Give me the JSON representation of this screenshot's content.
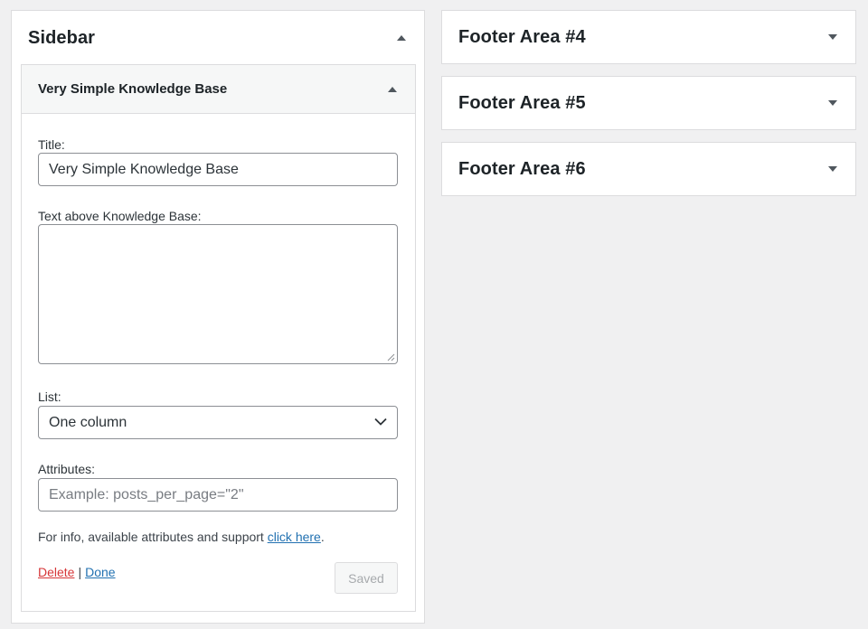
{
  "sidebar": {
    "title": "Sidebar",
    "widget": {
      "title": "Very Simple Knowledge Base",
      "title_label": "Title:",
      "title_value": "Very Simple Knowledge Base",
      "text_label": "Text above Knowledge Base:",
      "text_value": "",
      "list_label": "List:",
      "list_value": "One column",
      "attributes_label": "Attributes:",
      "attributes_placeholder": "Example: posts_per_page=\"2\"",
      "info_text": "For info, available attributes and support ",
      "info_link": "click here",
      "info_end": ".",
      "delete_label": "Delete",
      "separator": "|",
      "done_label": "Done",
      "saved_label": "Saved"
    }
  },
  "footer_areas": [
    {
      "title": "Footer Area #4"
    },
    {
      "title": "Footer Area #5"
    },
    {
      "title": "Footer Area #6"
    }
  ],
  "icons": {
    "collapse": "arrow-up-icon",
    "expand": "arrow-down-icon",
    "select": "chevron-down-icon",
    "resize": "resize-handle-icon"
  },
  "colors": {
    "link": "#2271b1",
    "delete": "#d63638",
    "background": "#f0f0f1"
  }
}
